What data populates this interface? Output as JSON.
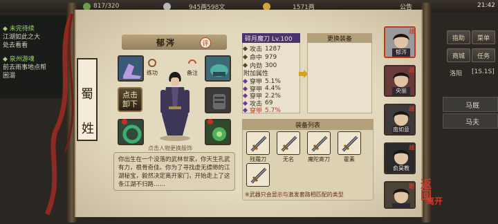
{
  "topbar": {
    "stamina": "817/320",
    "silver": "945两598文",
    "gold": "1571两",
    "notice": "公告",
    "time": "21:42"
  },
  "quest": {
    "title1": "◆ 未完待续",
    "text1a": "江湖如此之大",
    "text1b": "处去看看",
    "title2": "◆ 泉州游魂",
    "text2a": "前去雨事地点帮",
    "text2b": "困溺"
  },
  "right_menu": {
    "btn_assist": "指助",
    "btn_menu": "菜单",
    "btn_shop": "商城",
    "btn_tasks": "任务",
    "loc": "洛阳",
    "coord": "[1S.1S]",
    "list1": "马厩",
    "list2": "马夫"
  },
  "name_strip": {
    "c1": "蜀",
    "c2": "姓"
  },
  "character": {
    "name": "郁涔",
    "rating_badge": "评",
    "btn_practice": "练功",
    "btn_dress": "备注",
    "unequip_line1": "点击",
    "unequip_line2": "卸下",
    "hint": "点击人物更换服饰",
    "bio": "你出生在一个没落的武林世家，你天生孔武有力，根骨奇佳。你为了寻找虚无缥缈的江湖秘宝，毅然决定离开家门，开始走上了这条江湖不归路……"
  },
  "weapon": {
    "title": "碎月魔刀 Lv.100",
    "base": [
      {
        "k": "攻击",
        "v": "1287"
      },
      {
        "k": "命中",
        "v": "979"
      },
      {
        "k": "内劲",
        "v": "300"
      }
    ],
    "extra_head": "附加属性",
    "extra": [
      {
        "k": "穿甲",
        "v": "5.1%",
        "red": false
      },
      {
        "k": "穿甲",
        "v": "4.4%",
        "red": false
      },
      {
        "k": "穿甲",
        "v": "2.2%",
        "red": false
      },
      {
        "k": "攻击",
        "v": "69",
        "red": false
      },
      {
        "k": "穿甲",
        "v": "5.7%",
        "red": true
      }
    ]
  },
  "change": {
    "title": "更换装备"
  },
  "equipment_list": {
    "title": "装备列表",
    "items": [
      {
        "label": "残霜刀"
      },
      {
        "label": "无名"
      },
      {
        "label": "魔陀寄刀"
      },
      {
        "label": "霍素"
      },
      {
        "label": ""
      }
    ],
    "footnote": "※武器只会显示与激发套路相匹配的类型"
  },
  "party": [
    {
      "name": "郁涔",
      "tag": "战",
      "selected": true
    },
    {
      "name": "央丽",
      "tag": "战",
      "selected": false
    },
    {
      "name": "南如意",
      "tag": "战",
      "selected": false
    },
    {
      "name": "俞昊教",
      "tag": "战",
      "selected": false
    },
    {
      "name": "",
      "tag": "助",
      "selected": false
    }
  ],
  "back": {
    "line1": "返回",
    "line2": "离开"
  },
  "colors": {
    "paper": "#e3d9bf",
    "weapon_title": "#4a3170",
    "red": "#b0372d",
    "gold": "#d4b87a"
  }
}
